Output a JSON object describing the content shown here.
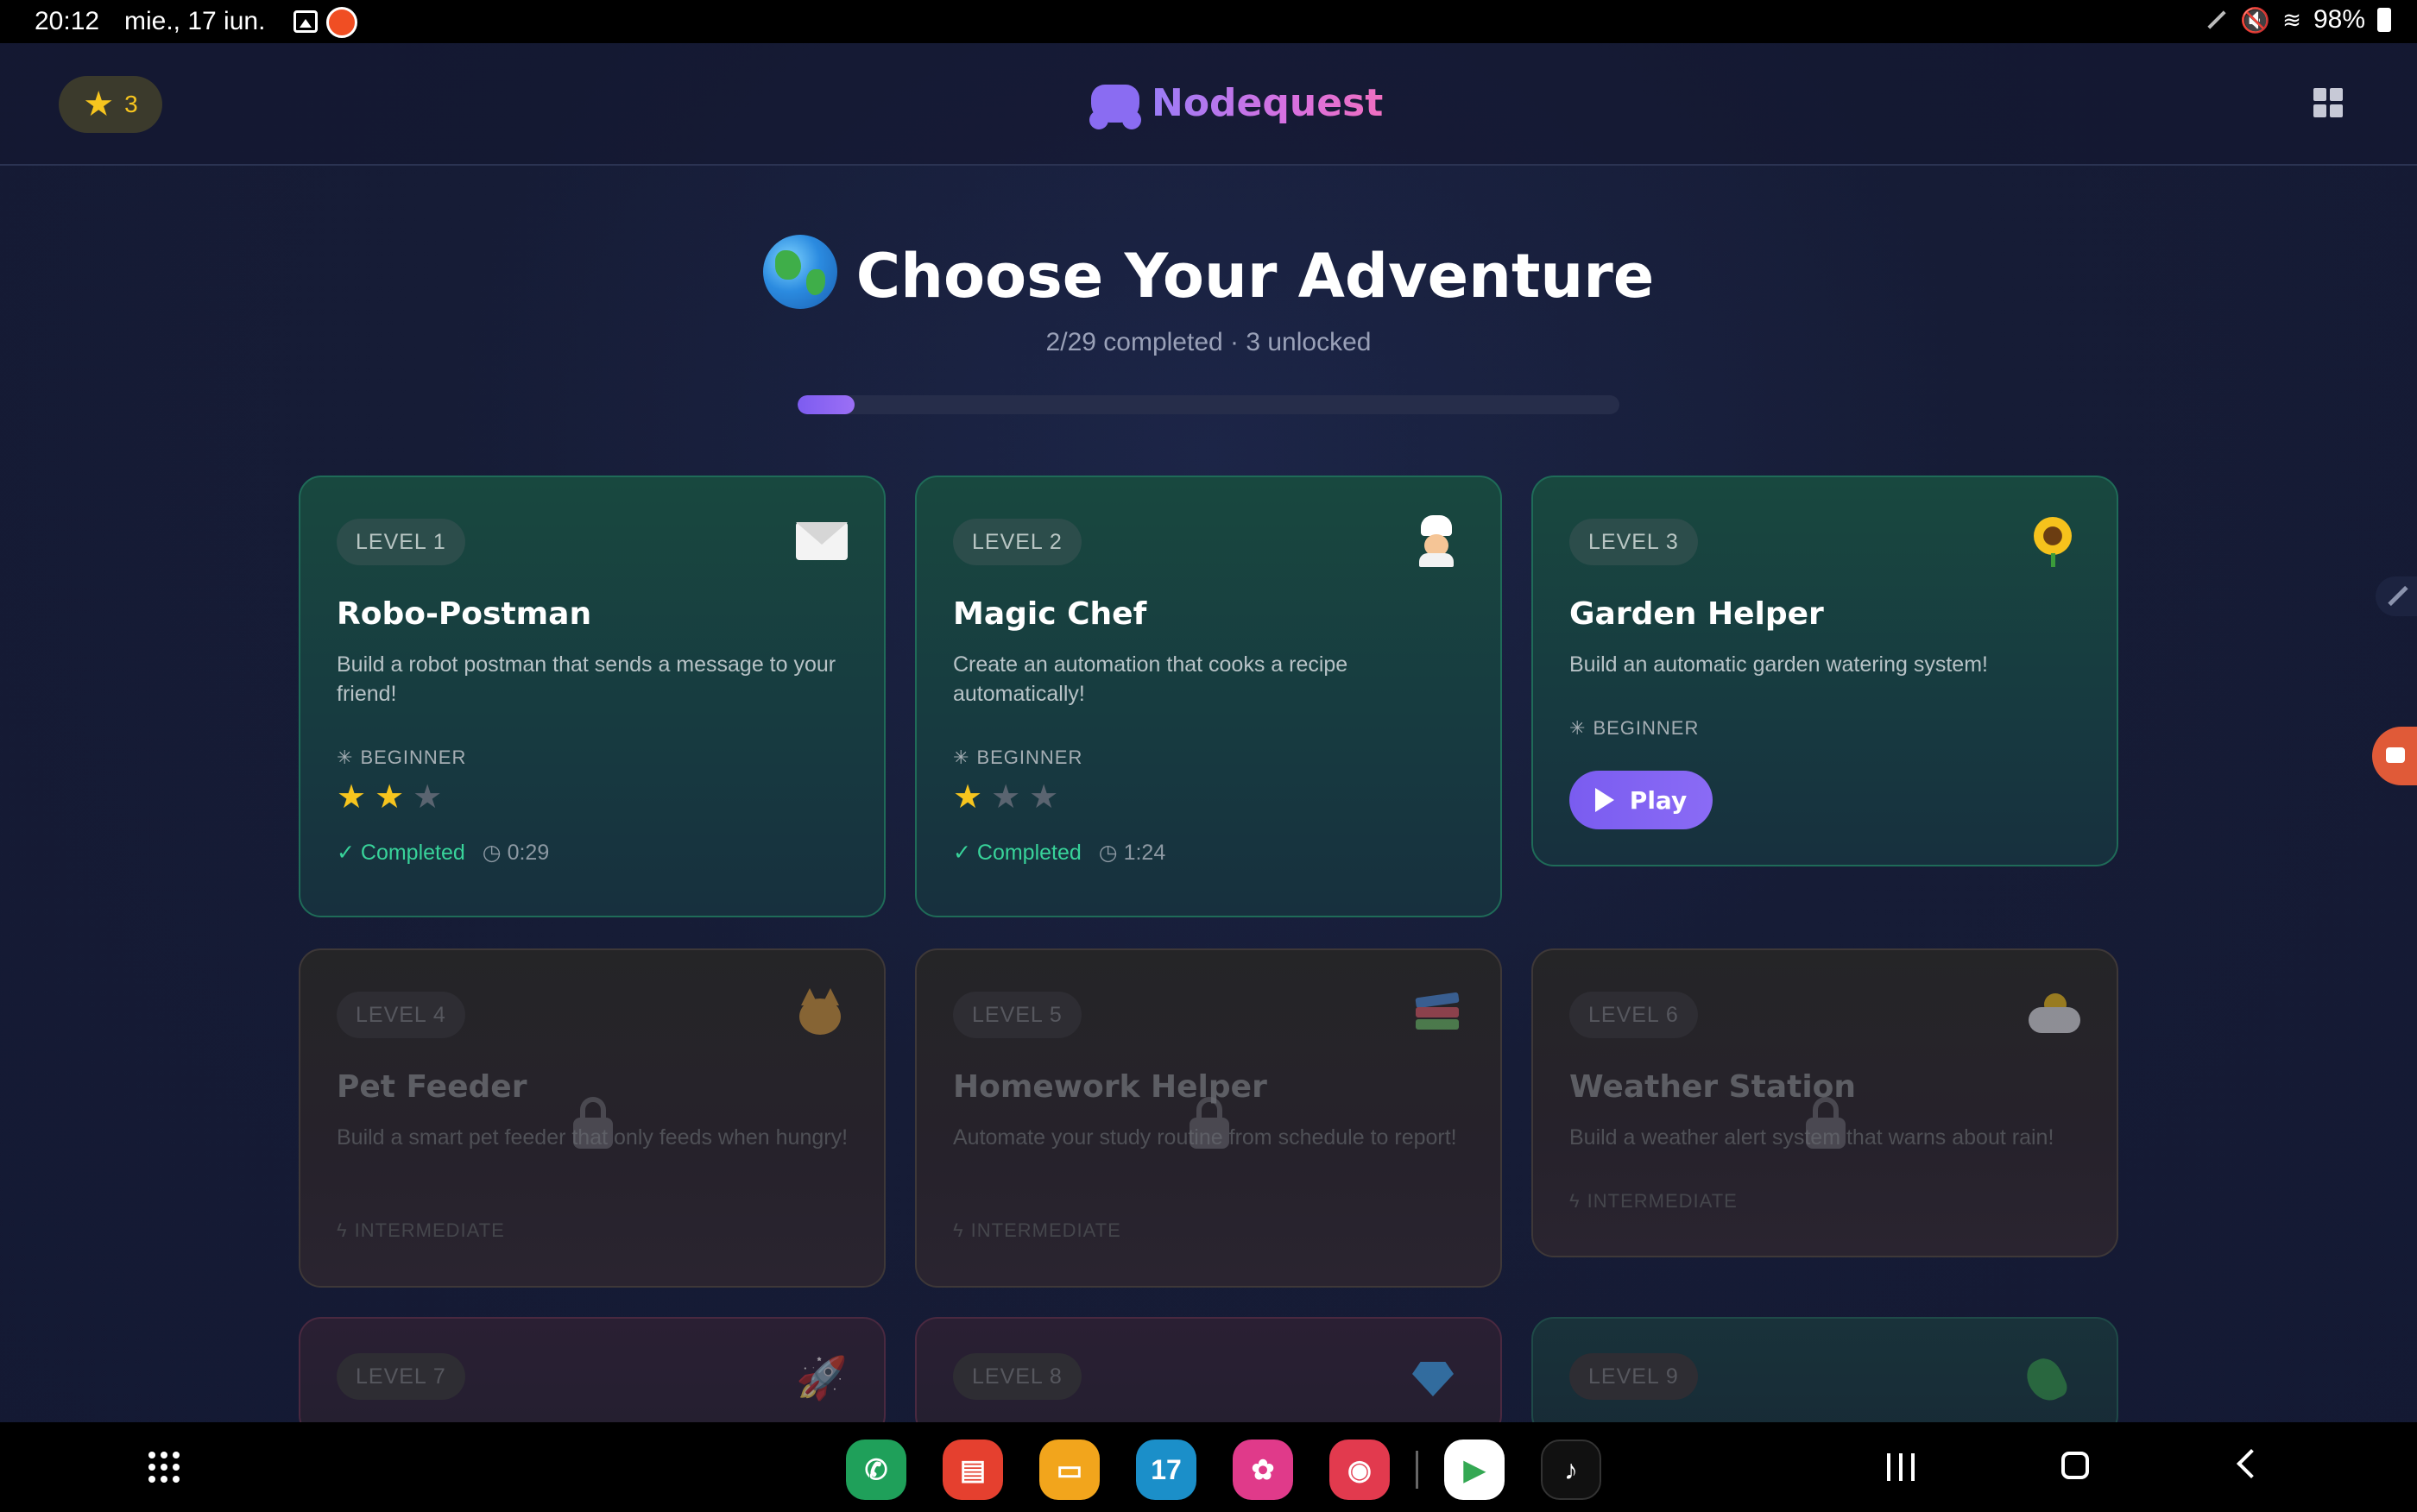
{
  "status_bar": {
    "time": "20:12",
    "date": "mie., 17 iun.",
    "battery": "98%"
  },
  "header": {
    "star_count": "3",
    "brand": "Nodequest",
    "brand_gradient": [
      "#9a7cf7",
      "#ef6fc0"
    ]
  },
  "hero": {
    "title": "Choose Your Adventure",
    "subtitle": "2/29 completed · 3 unlocked",
    "progress_fraction": 0.069
  },
  "colors": {
    "accent": "#7d5cf0",
    "star": "#f7c51e",
    "success": "#38d39a"
  },
  "levels": [
    {
      "level": "LEVEL 1",
      "icon": "envelope-icon",
      "title": "Robo-Postman",
      "description": "Build a robot postman that sends a message to your friend!",
      "difficulty": "BEGINNER",
      "stars": 2,
      "status": "✓ Completed",
      "time": "0:29"
    },
    {
      "level": "LEVEL 2",
      "icon": "chef-icon",
      "title": "Magic Chef",
      "description": "Create an automation that cooks a recipe automatically!",
      "difficulty": "BEGINNER",
      "stars": 1,
      "status": "✓ Completed",
      "time": "1:24"
    },
    {
      "level": "LEVEL 3",
      "icon": "sunflower-icon",
      "title": "Garden Helper",
      "description": "Build an automatic garden watering system!",
      "difficulty": "BEGINNER",
      "play_label": "Play"
    },
    {
      "level": "LEVEL 4",
      "icon": "cat-icon",
      "title": "Pet Feeder",
      "description": "Build a smart pet feeder that only feeds when hungry!",
      "difficulty": "INTERMEDIATE",
      "locked": true
    },
    {
      "level": "LEVEL 5",
      "icon": "books-icon",
      "title": "Homework Helper",
      "description": "Automate your study routine from schedule to report!",
      "difficulty": "INTERMEDIATE",
      "locked": true
    },
    {
      "level": "LEVEL 6",
      "icon": "cloud-sun-icon",
      "title": "Weather Station",
      "description": "Build a weather alert system that warns about rain!",
      "difficulty": "INTERMEDIATE",
      "locked": true
    },
    {
      "level": "LEVEL 7",
      "icon": "rocket-icon",
      "locked": true
    },
    {
      "level": "LEVEL 8",
      "icon": "gem-icon",
      "locked": true
    },
    {
      "level": "LEVEL 9",
      "icon": "parrot-icon",
      "locked": true
    }
  ],
  "dock": {
    "calendar_day": "17"
  }
}
